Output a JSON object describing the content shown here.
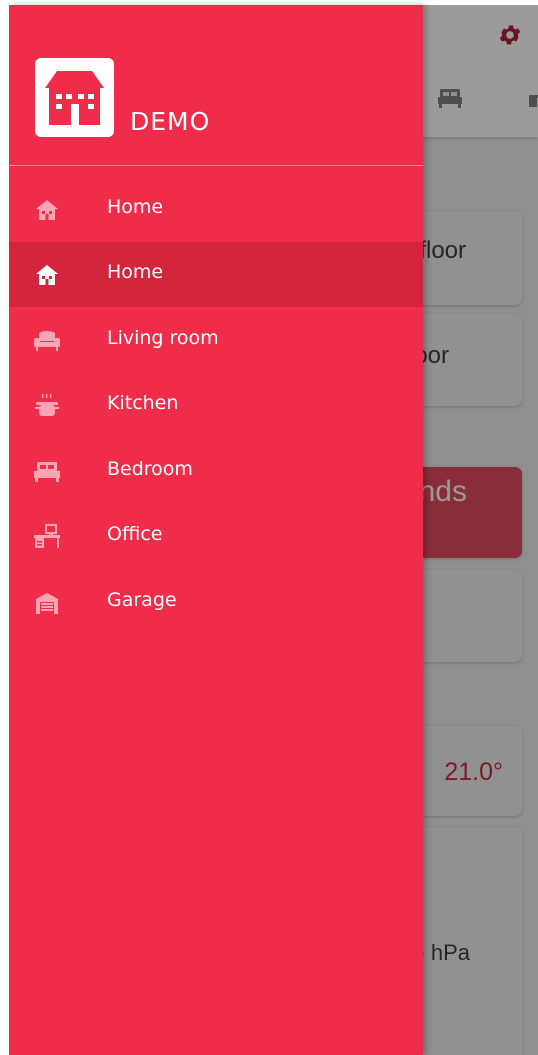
{
  "drawer": {
    "app_name": "DEMO",
    "items": [
      {
        "label": "Home",
        "icon": "home-icon",
        "active": false
      },
      {
        "label": "Home",
        "icon": "home-icon",
        "active": true
      },
      {
        "label": "Living room",
        "icon": "armchair-icon",
        "active": false
      },
      {
        "label": "Kitchen",
        "icon": "cooking-pot-icon",
        "active": false
      },
      {
        "label": "Bedroom",
        "icon": "bed-icon",
        "active": false
      },
      {
        "label": "Office",
        "icon": "desk-icon",
        "active": false
      },
      {
        "label": "Garage",
        "icon": "garage-icon",
        "active": false
      }
    ]
  },
  "background": {
    "cards": {
      "floor1": "floor",
      "floor2": "oor",
      "scenes": "nds",
      "temperature": "21.0°",
      "pressure": ") hPa"
    }
  },
  "colors": {
    "drawer_bg": "#ef2c4a",
    "active_item_bg": "#d4253d",
    "icon_tint": "#f9a5b4",
    "scrim_bg": "#8f8f8f",
    "settings_icon": "#6b1521"
  }
}
